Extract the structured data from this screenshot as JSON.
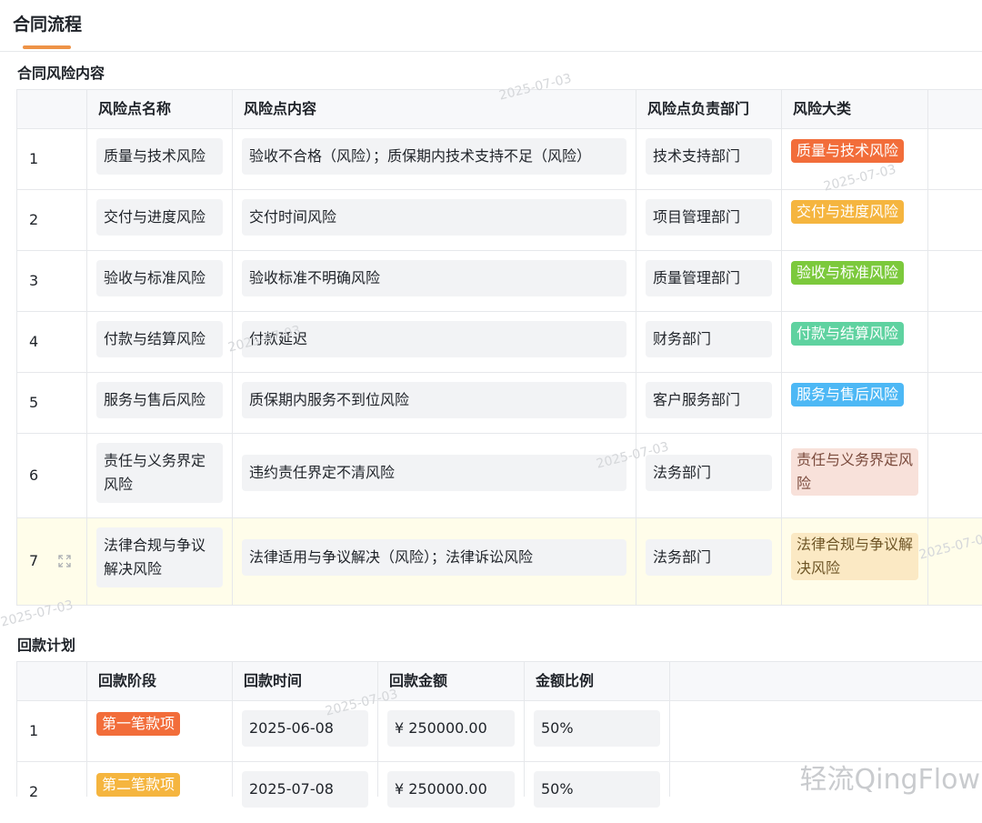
{
  "page": {
    "title": "合同流程",
    "risk_section_title": "合同风险内容",
    "payment_section_title": "回款计划",
    "watermark_date": "2025-07-03",
    "brand_watermark": "轻流QingFlow"
  },
  "risk_table": {
    "headers": [
      "风险点名称",
      "风险点内容",
      "风险点负责部门",
      "风险大类"
    ],
    "rows": [
      {
        "index": "1",
        "name": "质量与技术风险",
        "content": "验收不合格（风险）；质保期内技术支持不足（风险）",
        "department": "技术支持部门",
        "category": "质量与技术风险",
        "tag_bg": "#f26d3a",
        "tag_fg": "#ffffff"
      },
      {
        "index": "2",
        "name": "交付与进度风险",
        "content": "交付时间风险",
        "department": "项目管理部门",
        "category": "交付与进度风险",
        "tag_bg": "#f5b53f",
        "tag_fg": "#ffffff"
      },
      {
        "index": "3",
        "name": "验收与标准风险",
        "content": "验收标准不明确风险",
        "department": "质量管理部门",
        "category": "验收与标准风险",
        "tag_bg": "#7cc93c",
        "tag_fg": "#ffffff"
      },
      {
        "index": "4",
        "name": "付款与结算风险",
        "content": "付款延迟",
        "department": "财务部门",
        "category": "付款与结算风险",
        "tag_bg": "#5fd2a0",
        "tag_fg": "#ffffff"
      },
      {
        "index": "5",
        "name": "服务与售后风险",
        "content": "质保期内服务不到位风险",
        "department": "客户服务部门",
        "category": "服务与售后风险",
        "tag_bg": "#4db8f5",
        "tag_fg": "#ffffff"
      },
      {
        "index": "6",
        "name": "责任与义务界定风险",
        "content": "违约责任界定不清风险",
        "department": "法务部门",
        "category": "责任与义务界定风险",
        "tag_bg": "#f8e1da",
        "tag_fg": "#7a4a3c"
      },
      {
        "index": "7",
        "name": "法律合规与争议解决风险",
        "content": "法律适用与争议解决（风险）；法律诉讼风险",
        "department": "法务部门",
        "category": "法律合规与争议解决风险",
        "tag_bg": "#fbe9c4",
        "tag_fg": "#6e5526"
      }
    ]
  },
  "payment_table": {
    "headers": [
      "回款阶段",
      "回款时间",
      "回款金额",
      "金额比例"
    ],
    "rows": [
      {
        "index": "1",
        "stage": "第一笔款项",
        "date": "2025-06-08",
        "amount": "¥ 250000.00",
        "ratio": "50%",
        "tag_bg": "#f26d3a",
        "tag_fg": "#ffffff"
      },
      {
        "index": "2",
        "stage": "第二笔款项",
        "date": "2025-07-08",
        "amount": "¥ 250000.00",
        "ratio": "50%",
        "tag_bg": "#f5b53f",
        "tag_fg": "#ffffff"
      }
    ]
  },
  "icons": {
    "row_expand": "expand-icon"
  }
}
